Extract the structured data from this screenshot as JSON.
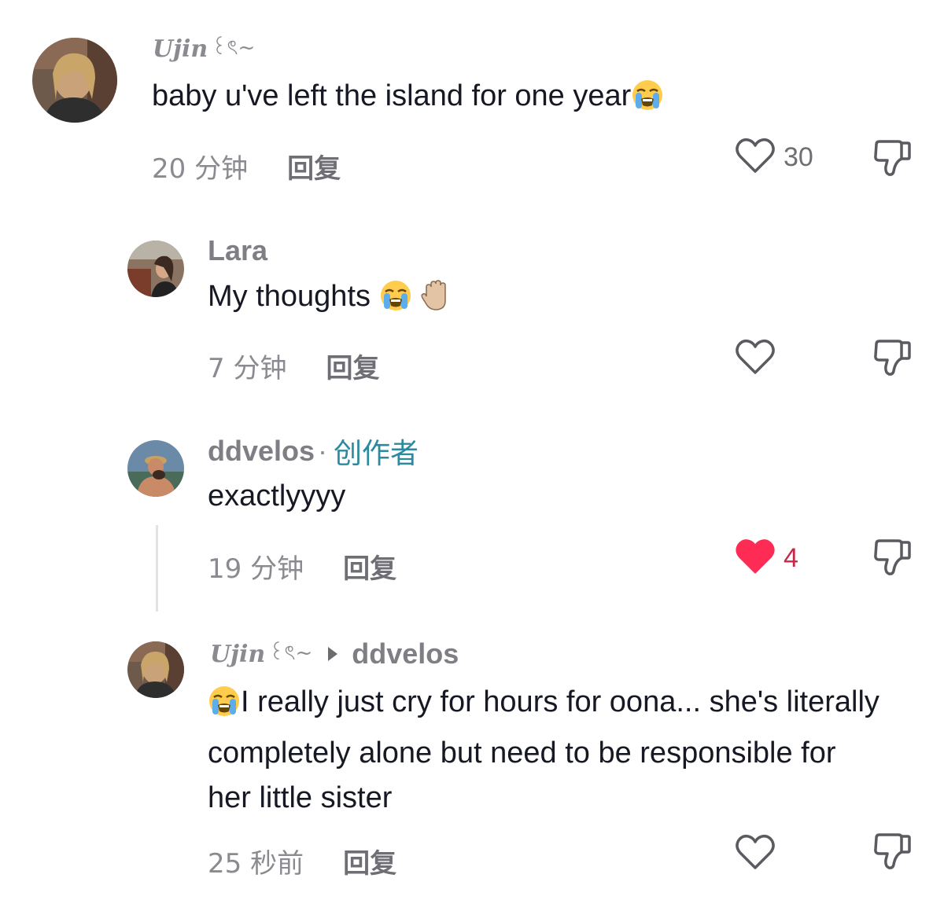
{
  "comments": [
    {
      "username_script": "Ujin",
      "username_deco": "꒰ৎ~",
      "text": "baby u've left the island for one year",
      "time": "20 分钟",
      "reply_label": "回复",
      "likes": "30",
      "liked": false
    },
    {
      "username": "Lara",
      "text": "My thoughts ",
      "time": "7 分钟",
      "reply_label": "回复",
      "likes": "",
      "liked": false
    },
    {
      "username": "ddvelos",
      "creator_dot": "·",
      "creator_badge": "创作者",
      "text": "exactlyyyy",
      "time": "19 分钟",
      "reply_label": "回复",
      "likes": "4",
      "liked": true
    },
    {
      "username_script": "Ujin",
      "username_deco": "꒰ৎ~",
      "reply_to": "ddvelos",
      "text": "I really just cry for hours for oona... she's literally completely alone but need to be responsible for her little sister",
      "time": "25 秒前",
      "reply_label": "回复",
      "likes": "",
      "liked": false
    }
  ],
  "icons": {
    "like": "heart-outline-icon",
    "liked": "heart-filled-icon",
    "dislike": "thumbs-down-icon",
    "crying": "loudly-crying-face-emoji",
    "hand": "raised-hand-emoji",
    "reply_arrow": "reply-arrow-icon"
  },
  "colors": {
    "liked_heart": "#fe2c55",
    "creator_badge": "#2a8a9e",
    "muted_text": "#8a8a90"
  }
}
